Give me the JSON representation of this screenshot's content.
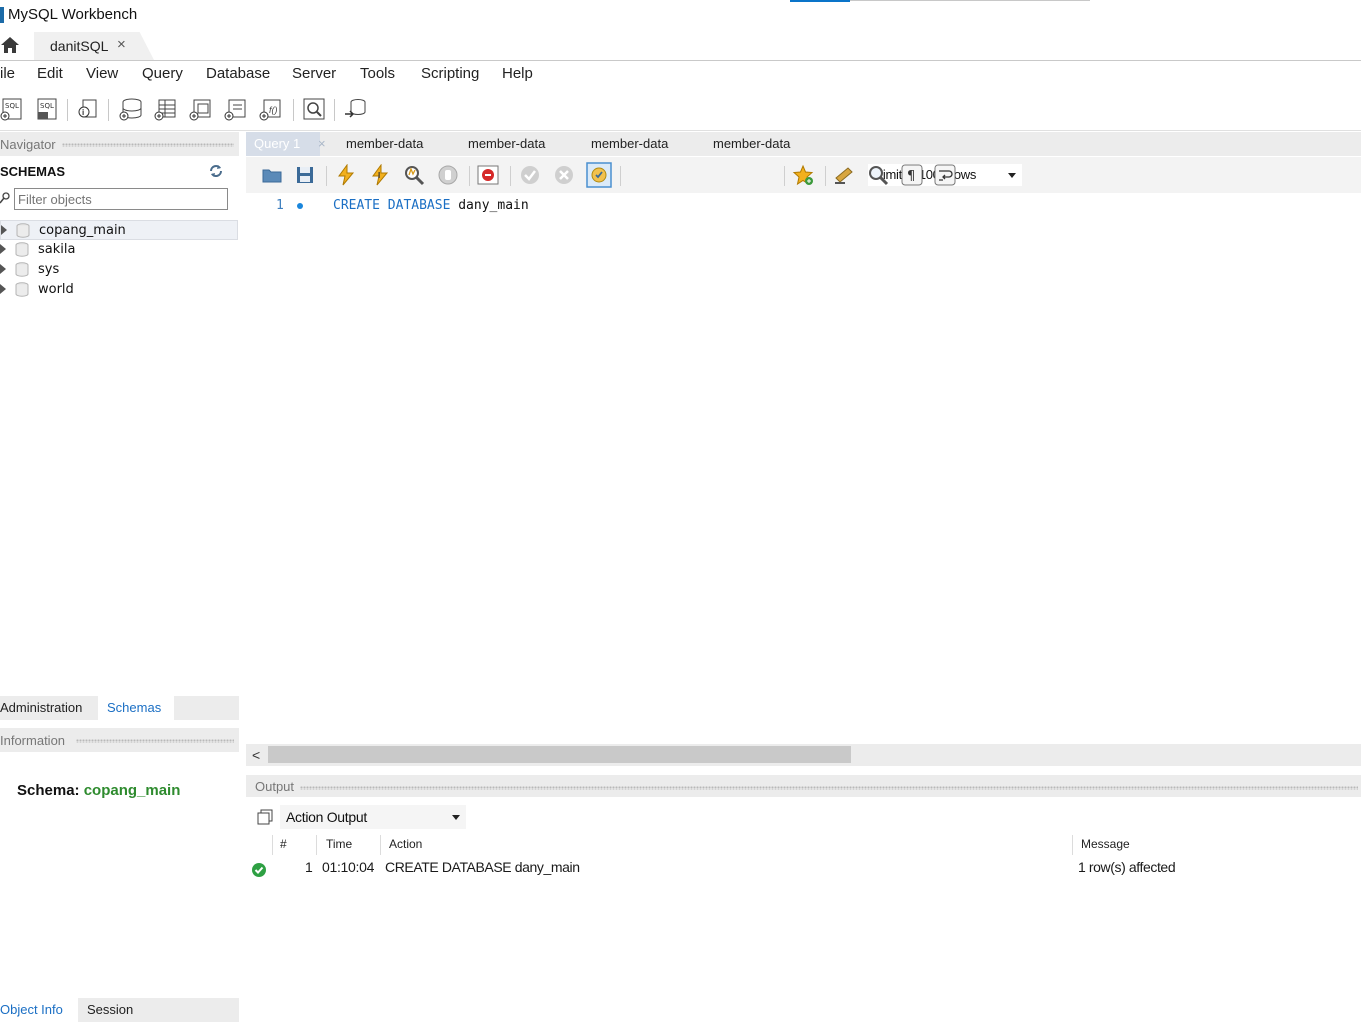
{
  "window": {
    "title": "MySQL Workbench"
  },
  "connection_tab": {
    "label": "danitSQL",
    "close": "×"
  },
  "menu": [
    "ile",
    "Edit",
    "View",
    "Query",
    "Database",
    "Server",
    "Tools",
    "Scripting",
    "Help"
  ],
  "navigator": {
    "header": "Navigator",
    "schemas_title": "SCHEMAS",
    "filter_placeholder": "Filter objects",
    "schemas": [
      "copang_main",
      "sakila",
      "sys",
      "world"
    ],
    "selected_schema": "copang_main",
    "bottom_tabs": {
      "administration": "Administration",
      "schemas": "Schemas"
    }
  },
  "information": {
    "header": "Information",
    "schema_label": "Schema:",
    "schema_value": "copang_main",
    "bottom_tabs": {
      "object_info": "Object Info",
      "session": "Session"
    }
  },
  "editor": {
    "tabs": [
      "Query 1",
      "member-data",
      "member-data",
      "member-data",
      "member-data"
    ],
    "active_tab": "Query 1",
    "limit_label": "Limit to 1000 rows",
    "line_number": "1",
    "code_keywords": "CREATE DATABASE",
    "code_identifier": "dany_main"
  },
  "output": {
    "header": "Output",
    "selector": "Action Output",
    "columns": {
      "num": "#",
      "time": "Time",
      "action": "Action",
      "message": "Message"
    },
    "rows": [
      {
        "num": "1",
        "time": "01:10:04",
        "action": "CREATE DATABASE dany_main",
        "message": "1 row(s) affected",
        "status": "success"
      }
    ]
  },
  "colors": {
    "accent": "#0a74c9",
    "keyword": "#1b6fc4",
    "schema_value": "#2e8b2e",
    "success": "#2ea043"
  },
  "icons": [
    "home-icon",
    "new-sql-tab-icon",
    "open-sql-script-icon",
    "inspector-icon",
    "create-schema-icon",
    "create-table-icon",
    "create-view-icon",
    "create-procedure-icon",
    "create-function-icon",
    "search-table-data-icon",
    "reconnect-icon"
  ]
}
